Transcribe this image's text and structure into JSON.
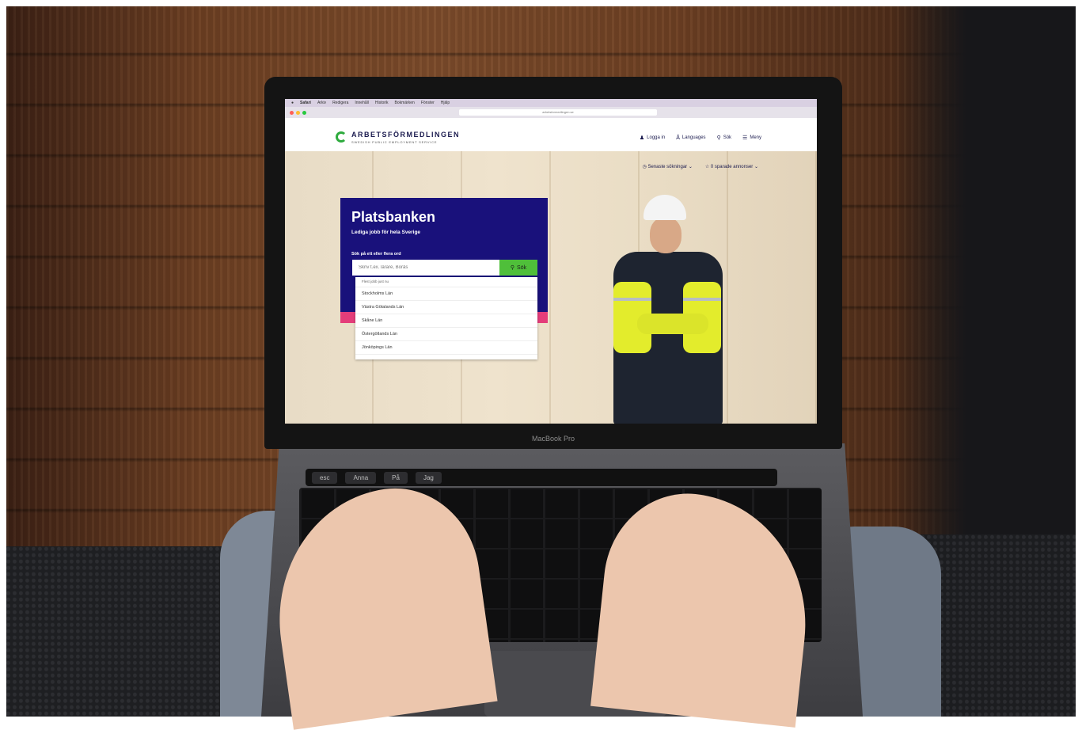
{
  "macbook_label": "MacBook Pro",
  "mac_menubar": {
    "app": "Safari",
    "items": [
      "Arkiv",
      "Redigera",
      "Innehåll",
      "Historik",
      "Bokmärken",
      "Fönster",
      "Hjälp"
    ]
  },
  "browser": {
    "url": "arbetsformedlingen.se"
  },
  "site": {
    "logo_name": "ARBETSFÖRMEDLINGEN",
    "logo_tagline": "SWEDISH PUBLIC EMPLOYMENT SERVICE",
    "nav": {
      "login": "Logga in",
      "languages": "Languages",
      "search": "Sök",
      "menu": "Meny"
    },
    "subnav": {
      "recent_searches": "Senaste sökningar",
      "saved_ads": "0 sparade annonser"
    }
  },
  "search_card": {
    "title": "Platsbanken",
    "subtitle": "Lediga jobb för hela Sverige",
    "label": "Sök på ett eller flera ord",
    "placeholder": "Skriv t.ex. lärare, Borås",
    "button": "Sök"
  },
  "dropdown": {
    "header": "Flest jobb just nu",
    "items": [
      "Stockholms Län",
      "Västra Götalands Län",
      "Skåne Län",
      "Östergötlands Län",
      "Jönköpings Län"
    ]
  },
  "touchbar": {
    "esc": "esc",
    "suggestions": [
      "Anna",
      "På",
      "Jag"
    ]
  },
  "colors": {
    "card_bg": "#19117b",
    "accent_pink": "#e43d7a",
    "search_green": "#4fbf3a",
    "logo_green": "#2eab3e"
  }
}
